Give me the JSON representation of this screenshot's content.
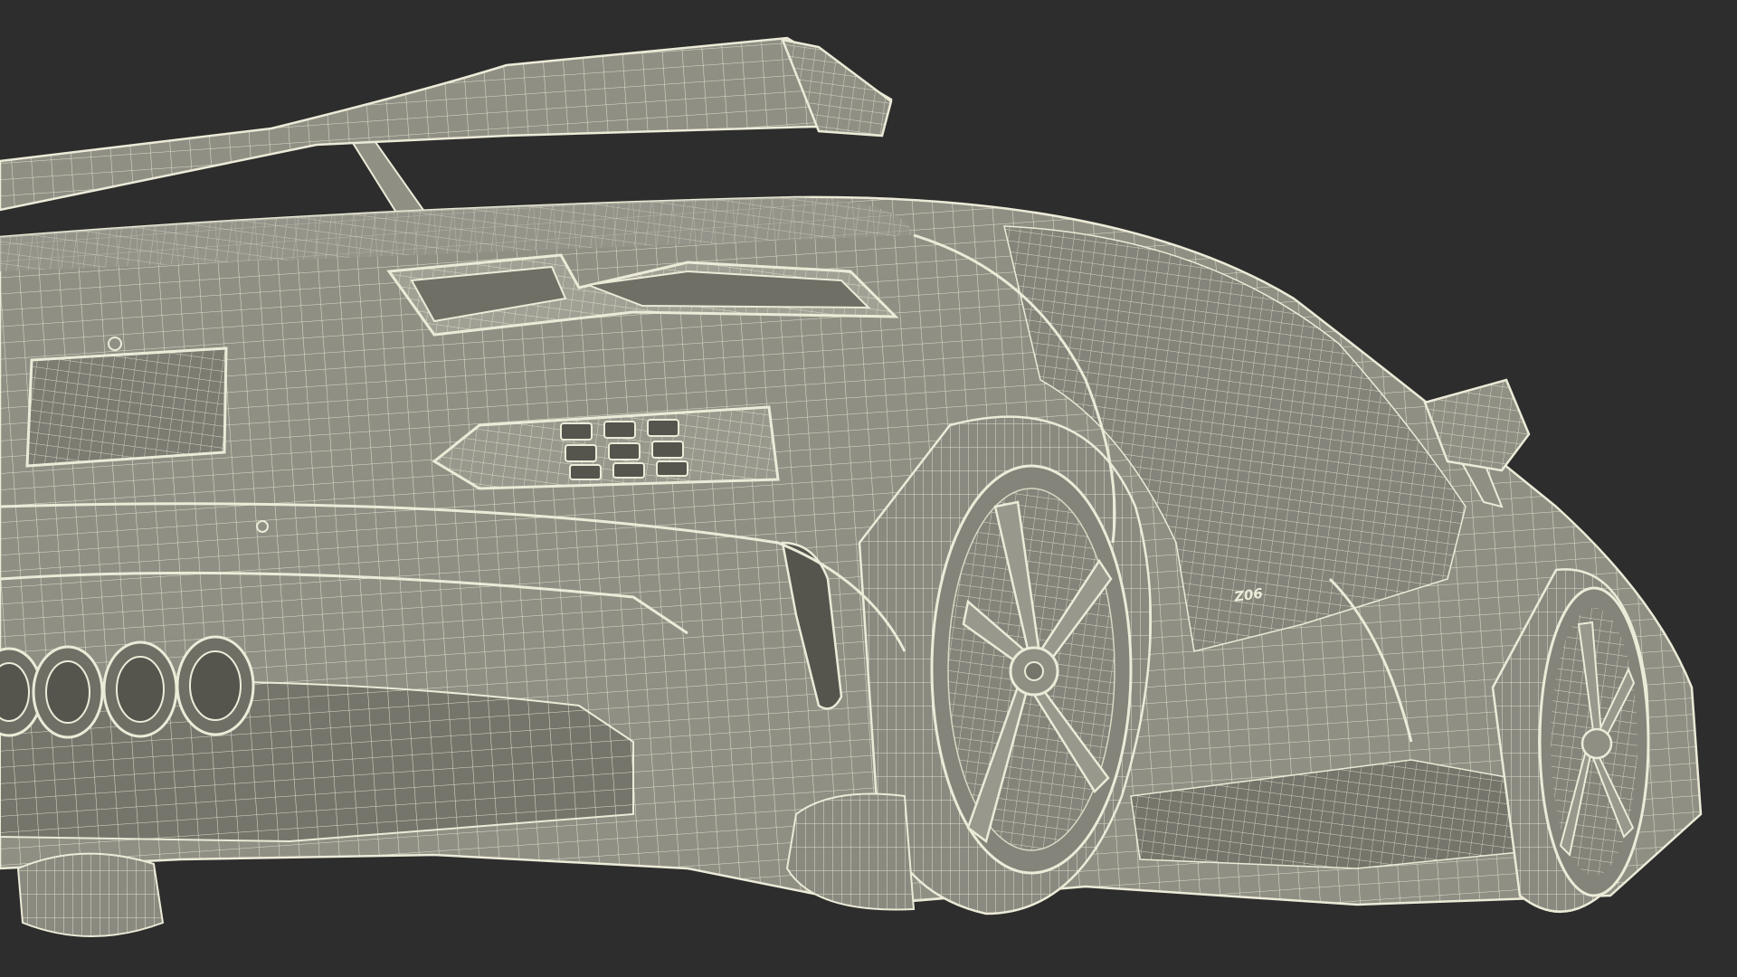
{
  "scene": {
    "subject": "sports-car-rear-wireframe-render",
    "badge_text": "Z06"
  },
  "colors": {
    "background": "#2d2d2d",
    "surface": "#8f8f84",
    "surface_dark": "#75756b",
    "shadow": "#5e5e56",
    "wire": "#ecebd8",
    "wire_soft": "#d9d8c4",
    "cavity": "#55554e"
  }
}
